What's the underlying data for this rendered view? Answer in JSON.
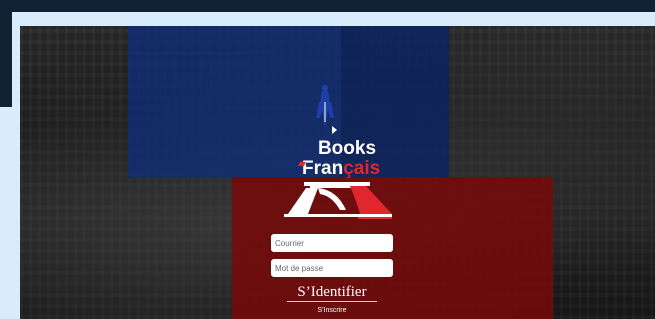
{
  "logo": {
    "line1": "Books",
    "line2_main": "Fran",
    "line2_accent": "çais"
  },
  "form": {
    "email_placeholder": "Courrier",
    "password_placeholder": "Mot de passe",
    "login_label": "S’Identifier",
    "register_label": "S'Inscrire"
  },
  "colors": {
    "brand_blue": "#1f3fa6",
    "brand_red": "#e0262f",
    "panel_red": "#780808",
    "panel_blue": "#0e2d78"
  },
  "icons": [
    "pen-nib-icon",
    "eiffel-tower-base-icon"
  ]
}
